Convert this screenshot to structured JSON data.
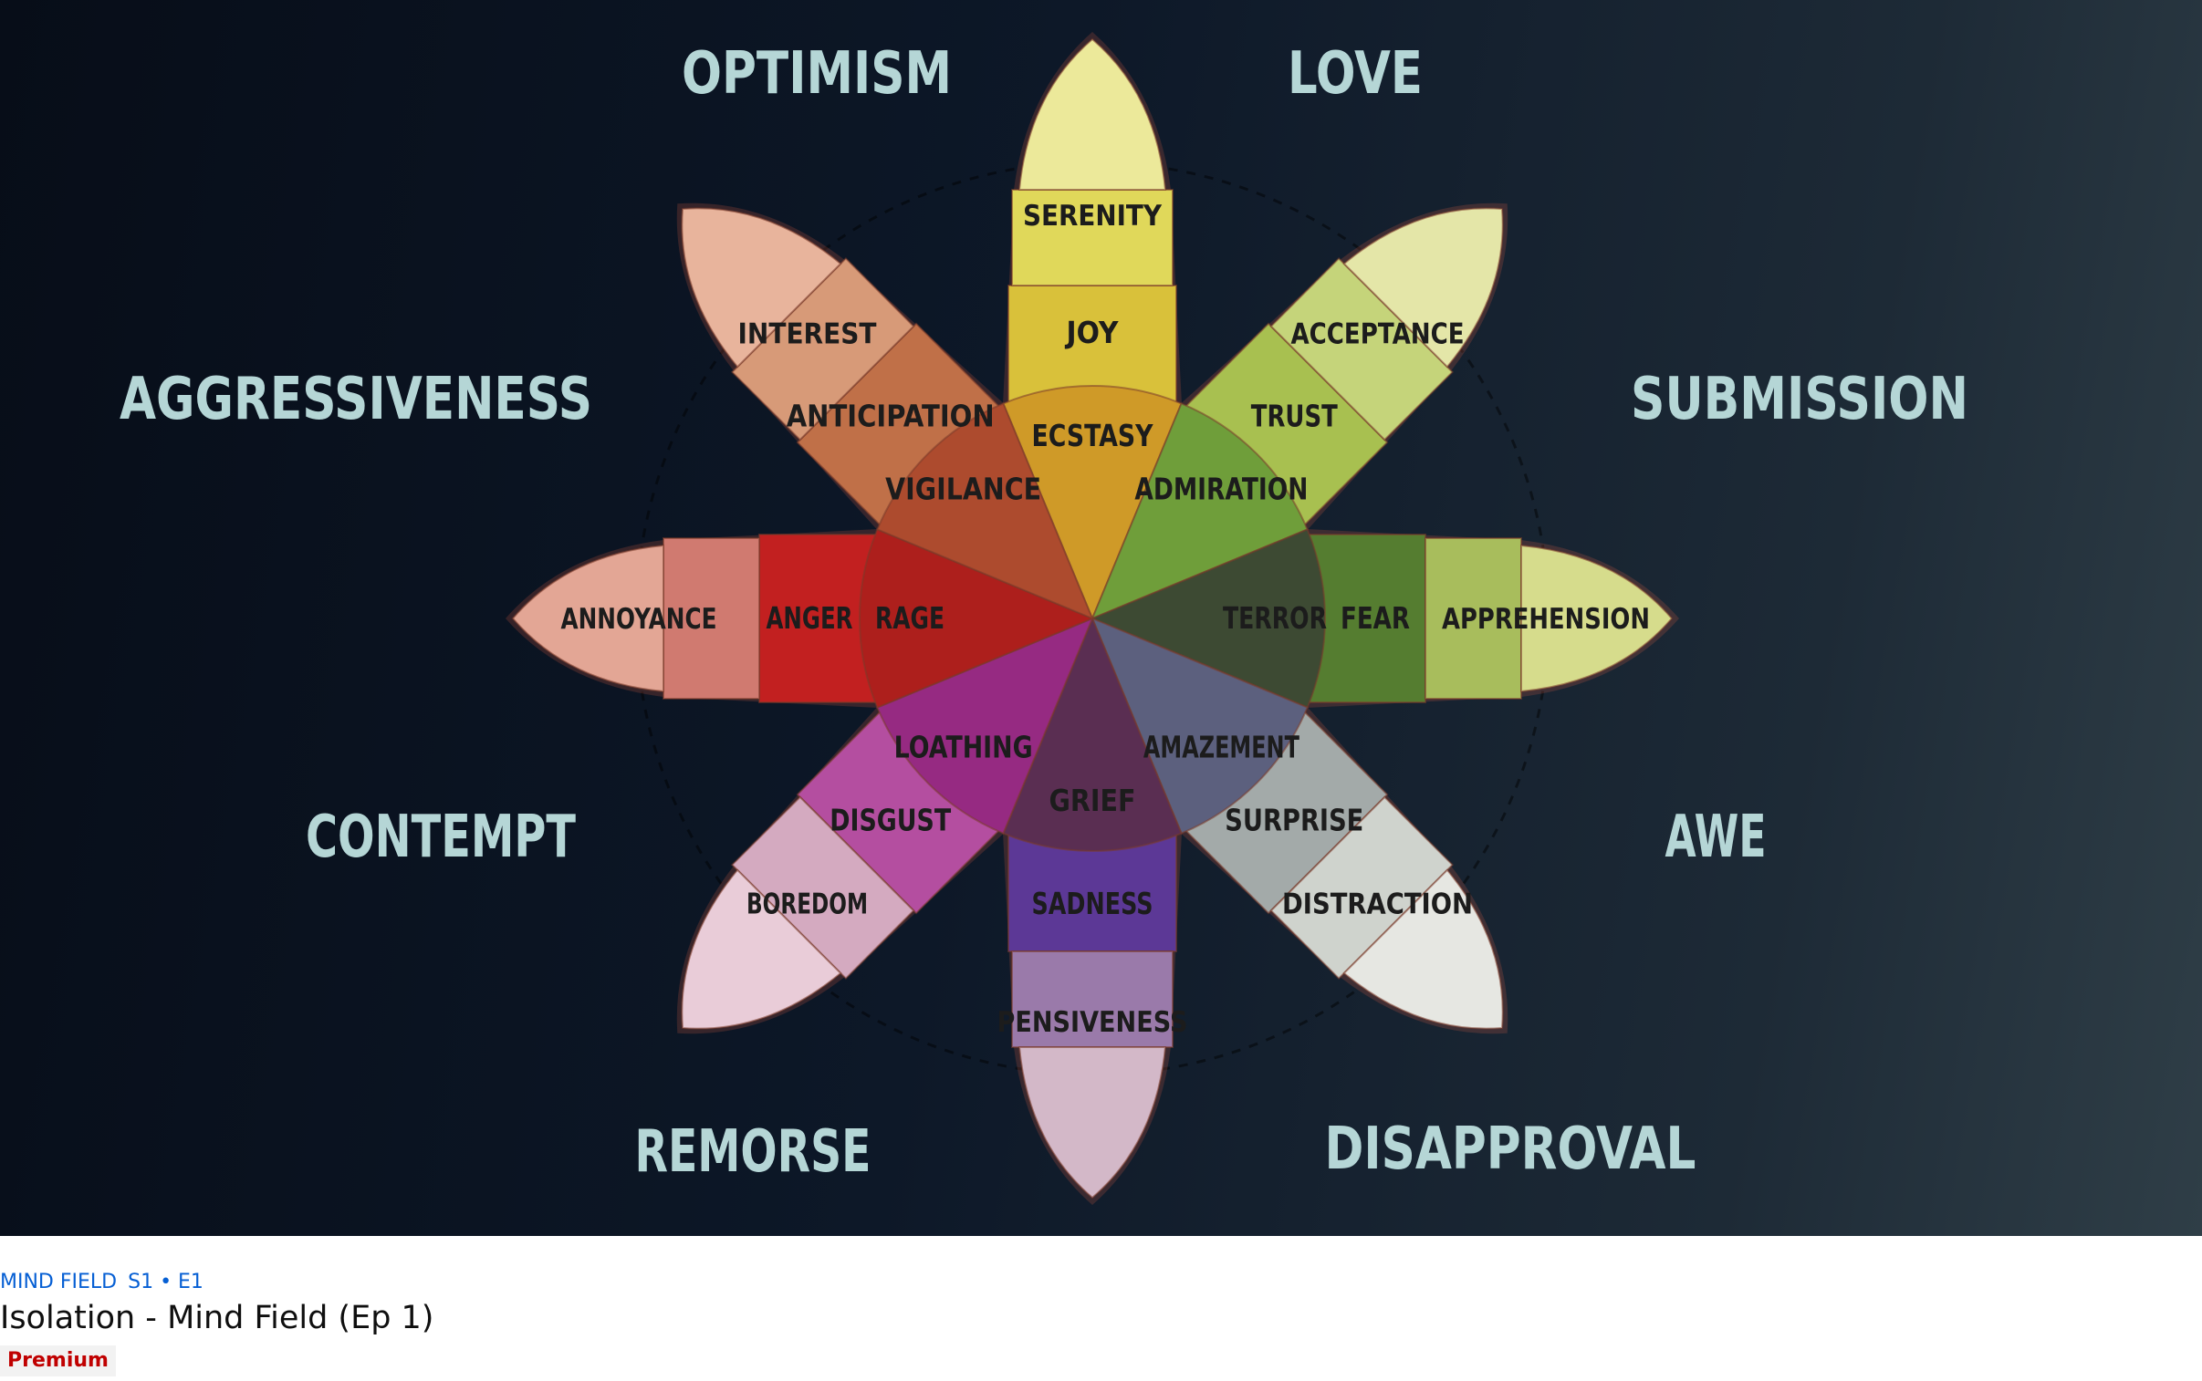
{
  "video": {
    "series": "MIND FIELD",
    "episode": "S1 • E1",
    "title": "Isolation - Mind Field (Ep 1)",
    "badge": "Premium"
  },
  "wheel": {
    "dyads": [
      "LOVE",
      "SUBMISSION",
      "AWE",
      "DISAPPROVAL",
      "REMORSE",
      "CONTEMPT",
      "AGGRESSIVENESS",
      "OPTIMISM"
    ],
    "petals": [
      {
        "intense": "ECSTASY",
        "basic": "JOY",
        "mild": "SERENITY",
        "c1": "#cf9a28",
        "c2": "#d9c13a",
        "c3": "#e0d85a",
        "tip": "#ece99a"
      },
      {
        "intense": "ADMIRATION",
        "basic": "TRUST",
        "mild": "ACCEPTANCE",
        "c1": "#6f9e3a",
        "c2": "#a8c050",
        "c3": "#c5d47a",
        "tip": "#e4e6a8"
      },
      {
        "intense": "TERROR",
        "basic": "FEAR",
        "mild": "APPREHENSION",
        "c1": "#3d4a33",
        "c2": "#557d30",
        "c3": "#a8bd5c",
        "tip": "#d6dc8c"
      },
      {
        "intense": "AMAZEMENT",
        "basic": "SURPRISE",
        "mild": "DISTRACTION",
        "c1": "#5c607e",
        "c2": "#a3aaa9",
        "c3": "#cfd3cd",
        "tip": "#e6e7e2"
      },
      {
        "intense": "GRIEF",
        "basic": "SADNESS",
        "mild": "PENSIVENESS",
        "c1": "#5a2e52",
        "c2": "#5c3896",
        "c3": "#9a7aaa",
        "tip": "#d3b8c8"
      },
      {
        "intense": "LOATHING",
        "basic": "DISGUST",
        "mild": "BOREDOM",
        "c1": "#962a82",
        "c2": "#b44ea0",
        "c3": "#d4aac0",
        "tip": "#e9ccd8"
      },
      {
        "intense": "RAGE",
        "basic": "ANGER",
        "mild": "ANNOYANCE",
        "c1": "#ad1f1c",
        "c2": "#c22020",
        "c3": "#d07a70",
        "tip": "#e3a695"
      },
      {
        "intense": "VIGILANCE",
        "basic": "ANTICIPATION",
        "mild": "INTEREST",
        "c1": "#ad4b2e",
        "c2": "#c07048",
        "c3": "#d79a78",
        "tip": "#e8b49c"
      }
    ],
    "colors": {
      "dyad_label": "#b5d6d6",
      "emotion_label": "#1c1c1c",
      "outline": "#7a3a2a"
    }
  }
}
